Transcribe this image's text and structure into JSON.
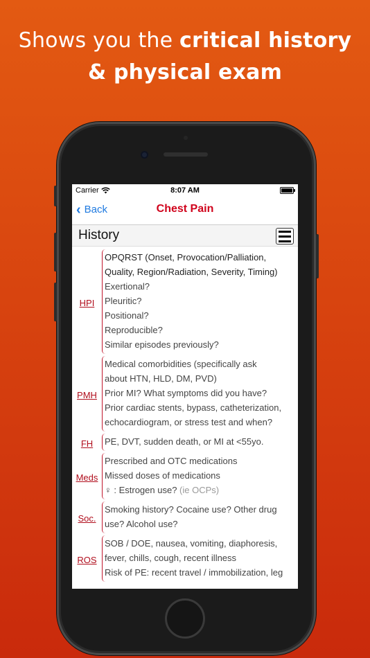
{
  "headline": {
    "line1_regular": "Shows you the ",
    "line1_bold": "critical history",
    "line2_bold": "& physical exam"
  },
  "status_bar": {
    "carrier": "Carrier",
    "time": "8:07 AM"
  },
  "nav": {
    "back_label": "Back",
    "title": "Chest Pain"
  },
  "section": {
    "title": "History"
  },
  "rows": [
    {
      "label": "HPI",
      "lines": [
        "OPQRST (Onset, Provocation/Palliation,",
        "Quality, Region/Radiation, Severity, Timing)",
        "Exertional?",
        "Pleuritic?",
        "Positional?",
        "Reproducible?",
        "Similar episodes previously?"
      ]
    },
    {
      "label": "PMH",
      "lines": [
        "Medical comorbidities (specifically ask",
        "about HTN, HLD, DM, PVD)",
        "Prior MI? What symptoms did you have?",
        "Prior cardiac stents, bypass, catheterization,",
        "echocardiogram, or stress test and when?"
      ]
    },
    {
      "label": "FH",
      "lines": [
        "PE, DVT, sudden death, or MI at <55yo."
      ]
    },
    {
      "label": "Meds",
      "lines": [
        "Prescribed and OTC medications",
        "Missed doses of medications"
      ],
      "extra": {
        "symbol": "♀",
        "text": " : Estrogen use? ",
        "muted": "(ie OCPs)"
      }
    },
    {
      "label": "Soc.",
      "lines": [
        "Smoking history? Cocaine use? Other drug",
        "use? Alcohol use?"
      ]
    },
    {
      "label": "ROS",
      "lines": [
        "SOB / DOE, nausea, vomiting, diaphoresis,",
        "fever, chills, cough, recent illness",
        "Risk of PE: recent travel / immobilization, leg"
      ]
    }
  ]
}
